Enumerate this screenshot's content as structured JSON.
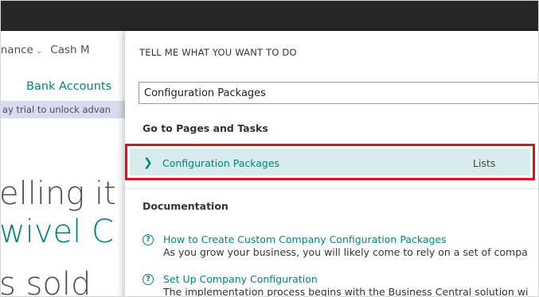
{
  "background_page": {
    "nav_items": [
      "inance",
      "Cash M"
    ],
    "link": "Bank Accounts",
    "trial_banner": "ay trial to unlock advan",
    "headline_lines": [
      "elling it",
      "wivel C",
      "s sold"
    ]
  },
  "tell_me": {
    "title": "TELL ME WHAT YOU WANT TO DO",
    "search_value": "Configuration Packages",
    "section_pages": "Go to Pages and Tasks",
    "result": {
      "label": "Configuration Packages",
      "category": "Lists"
    },
    "section_docs": "Documentation",
    "docs": [
      {
        "title": "How to Create Custom Company Configuration Packages",
        "description": "As you grow your business, you will likely come to rely on a set of compa"
      },
      {
        "title": "Set Up Company Configuration",
        "description": "The implementation process begins with the Business Central solution wi"
      }
    ]
  }
}
